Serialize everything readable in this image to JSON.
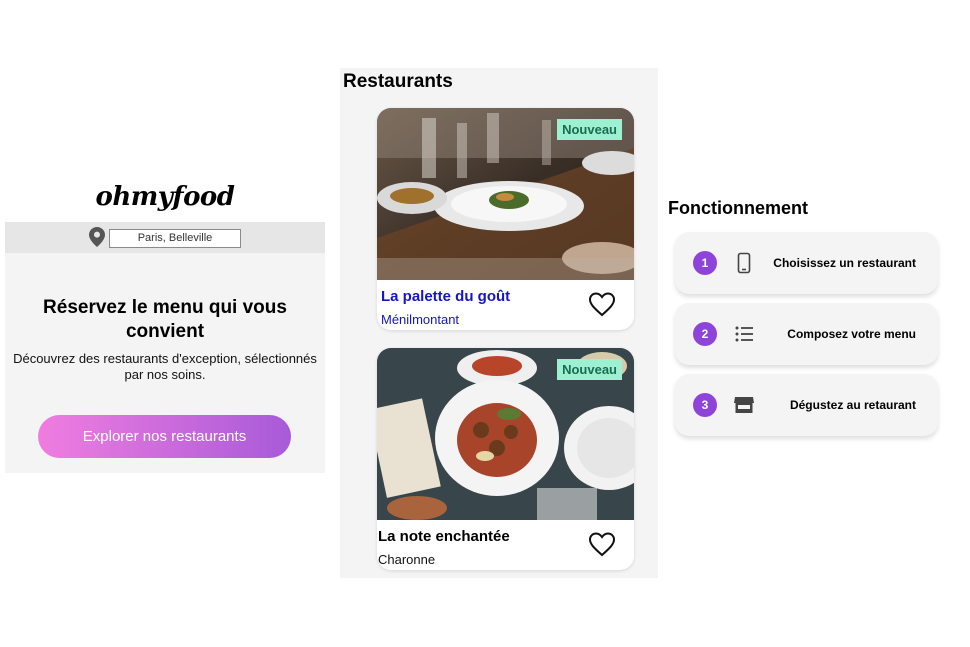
{
  "brand": {
    "logo_text": "ohmyfood"
  },
  "location": {
    "pin_icon": "map-pin-icon",
    "value": "Paris, Belleville"
  },
  "hero": {
    "title": "Réservez le menu qui vous convient",
    "subtitle": "Découvrez des restaurants d'exception, sélectionnés par nos soins.",
    "cta_label": "Explorer nos restaurants",
    "cta_colors": [
      "#f07de0",
      "#a85ad8"
    ]
  },
  "restaurants": {
    "title": "Restaurants",
    "items": [
      {
        "name": "La palette du goût",
        "place": "Ménilmontant",
        "badge": "Nouveau",
        "favorite_icon": "heart-outline-icon",
        "name_color": "#1515c8"
      },
      {
        "name": "La note enchantée",
        "place": "Charonne",
        "badge": "Nouveau",
        "favorite_icon": "heart-outline-icon",
        "name_color": "#000000"
      }
    ],
    "badge_color": "#9ef0d2"
  },
  "how_it_works": {
    "title": "Fonctionnement",
    "steps": [
      {
        "number": "1",
        "icon": "smartphone-icon",
        "label": "Choisissez un restaurant"
      },
      {
        "number": "2",
        "icon": "list-icon",
        "label": "Composez votre menu"
      },
      {
        "number": "3",
        "icon": "storefront-icon",
        "label": "Dégustez au retaurant"
      }
    ],
    "number_color": "#8e44d8"
  }
}
